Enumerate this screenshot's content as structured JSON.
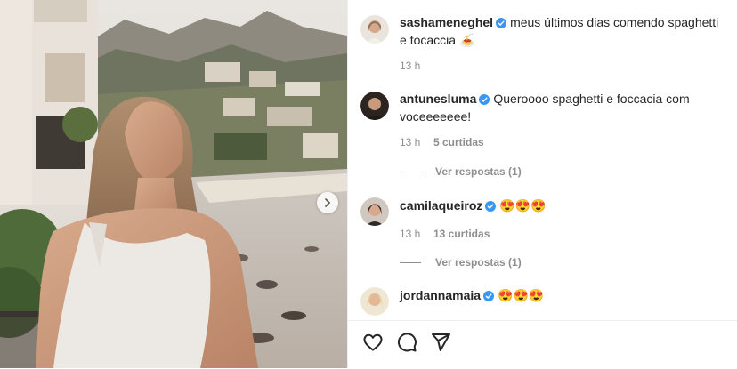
{
  "post": {
    "author": "sashameneghel",
    "caption": "meus últimos dias comendo spaghetti e focaccia",
    "caption_emoji": "🍝",
    "time": "13 h"
  },
  "comments": [
    {
      "user": "antunesluma",
      "text": "Queroooo spaghetti e foccacia com voceeeeeee!",
      "time": "13 h",
      "likes": "5 curtidas",
      "replies": "Ver respostas (1)"
    },
    {
      "user": "camilaqueiroz",
      "text": "😍😍😍",
      "time": "13 h",
      "likes": "13 curtidas",
      "replies": "Ver respostas (1)"
    },
    {
      "user": "jordannamaia",
      "text": "😍😍😍"
    }
  ],
  "icons": {
    "verified": "verified-badge-icon",
    "like": "heart-icon",
    "comment": "comment-icon",
    "share": "share-icon",
    "next": "chevron-right-icon"
  },
  "colors": {
    "verified": "#3897f0",
    "muted": "#8e8e8e",
    "text": "#262626"
  }
}
